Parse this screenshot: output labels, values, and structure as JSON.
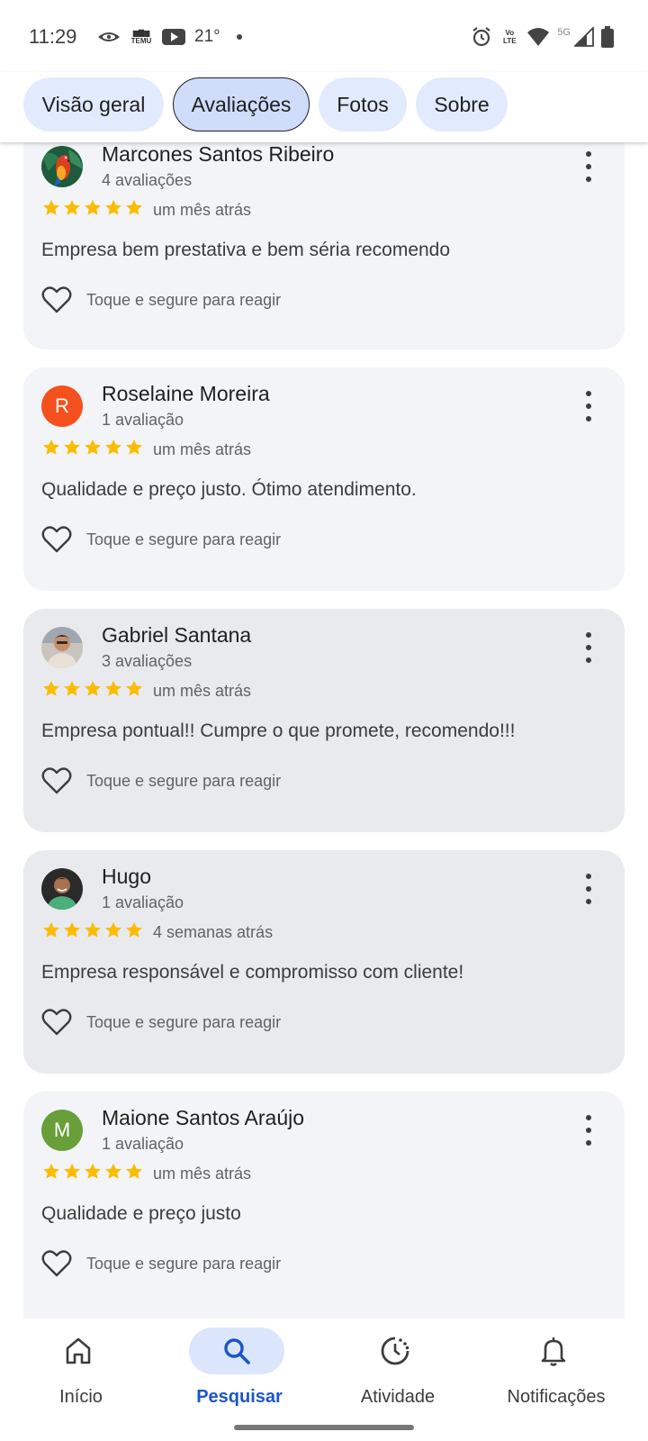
{
  "status_bar": {
    "time": "11:29",
    "temu_label": "TEMU",
    "temperature": "21°",
    "volte_label": "Vo LTE",
    "network": "5G",
    "icons": [
      "eye-icon",
      "temu-icon",
      "youtube-icon",
      "alarm-icon",
      "volte-icon",
      "wifi-icon",
      "signal-icon",
      "battery-icon"
    ]
  },
  "tabs": [
    {
      "label": "Visão geral",
      "active": false
    },
    {
      "label": "Avaliações",
      "active": true
    },
    {
      "label": "Fotos",
      "active": false
    },
    {
      "label": "Sobre",
      "active": false
    }
  ],
  "reviews": [
    {
      "name": "Marcones Santos Ribeiro",
      "count": "4 avaliações",
      "rating": 5,
      "date": "um mês atrás",
      "text": "Empresa bem prestativa e bem séria recomendo",
      "react_label": "Toque e segure para reagir",
      "avatar": "parrot-photo"
    },
    {
      "name": "Roselaine Moreira",
      "count": "1 avaliação",
      "rating": 5,
      "date": "um mês atrás",
      "text": "Qualidade e preço justo. Ótimo atendimento.",
      "react_label": "Toque e segure para reagir",
      "avatar_letter": "R",
      "avatar_color": "#f4511e"
    },
    {
      "name": "Gabriel Santana",
      "count": "3 avaliações",
      "rating": 5,
      "date": "um mês atrás",
      "text": "Empresa pontual!! Cumpre o que promete, recomendo!!!",
      "react_label": "Toque e segure para reagir",
      "avatar": "person-photo"
    },
    {
      "name": "Hugo",
      "count": "1 avaliação",
      "rating": 5,
      "date": "4 semanas atrás",
      "text": "Empresa responsável e compromisso com cliente!",
      "react_label": "Toque e segure para reagir",
      "avatar": "person-photo"
    },
    {
      "name": "Maione Santos Araújo",
      "count": "1 avaliação",
      "rating": 5,
      "date": "um mês atrás",
      "text": "Qualidade e preço justo",
      "react_label": "Toque e segure para reagir",
      "avatar_letter": "M",
      "avatar_color": "#689f38"
    }
  ],
  "colors": {
    "star": "#fbbc04",
    "accent": "#1a56c8"
  },
  "bottom_nav": [
    {
      "label": "Início",
      "icon": "home-icon",
      "active": false
    },
    {
      "label": "Pesquisar",
      "icon": "search-icon",
      "active": true
    },
    {
      "label": "Atividade",
      "icon": "activity-icon",
      "active": false
    },
    {
      "label": "Notificações",
      "icon": "bell-icon",
      "active": false
    }
  ]
}
